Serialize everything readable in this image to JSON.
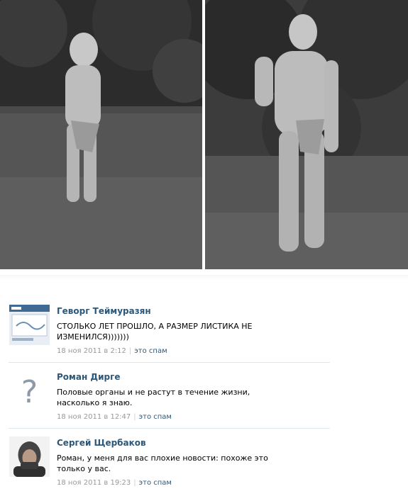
{
  "photos": {
    "left": {
      "alt": ""
    },
    "right": {
      "alt": ""
    }
  },
  "comments": [
    {
      "author": "Геворг Теймуразян",
      "text": "СТОЛЬКО ЛЕТ ПРОШЛО, А РАЗМЕР ЛИСТИКА НЕ ИЗМЕНИЛСЯ)))))))",
      "date": "18 ноя 2011 в 2:12",
      "spam_label": "это спам",
      "avatar": "screenshot-thumbnail"
    },
    {
      "author": "Роман Дирге",
      "text": "Половые органы и не растут в течение жизни, насколько я знаю.",
      "date": "18 ноя 2011 в 12:47",
      "spam_label": "это спам",
      "avatar": "question-mark-icon"
    },
    {
      "author": "Сергей Щербаков",
      "text": "Роман, у меня для вас плохие новости: похоже это только у вас.",
      "date": "18 ноя 2011 в 19:23",
      "spam_label": "это спам",
      "avatar": "person-photo"
    }
  ],
  "colors": {
    "author": "#2b587a",
    "meta": "#999999",
    "divider": "#dfe6ee"
  }
}
